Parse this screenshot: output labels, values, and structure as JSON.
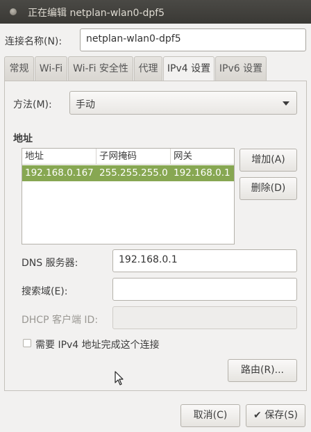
{
  "window": {
    "title": "正在编辑 netplan-wlan0-dpf5"
  },
  "connection": {
    "label": "连接名称(N):",
    "value": "netplan-wlan0-dpf5"
  },
  "tabs": [
    {
      "label": "常规"
    },
    {
      "label": "Wi-Fi"
    },
    {
      "label": "Wi-Fi 安全性"
    },
    {
      "label": "代理"
    },
    {
      "label": "IPv4 设置"
    },
    {
      "label": "IPv6 设置"
    }
  ],
  "active_tab": "IPv4 设置",
  "ipv4": {
    "method_label": "方法(M):",
    "method_value": "手动",
    "addresses_heading": "地址",
    "table": {
      "headers": [
        "地址",
        "子网掩码",
        "网关"
      ],
      "rows": [
        [
          "192.168.0.167",
          "255.255.255.0",
          "192.168.0.1"
        ]
      ]
    },
    "add_button": "增加(A)",
    "delete_button": "删除(D)",
    "dns_label": "DNS 服务器:",
    "dns_value": "192.168.0.1",
    "search_label": "搜索域(E):",
    "search_value": "",
    "dhcp_label": "DHCP 客户端 ID:",
    "dhcp_value": "",
    "require_ipv4_label": "需要 IPv4 地址完成这个连接",
    "require_ipv4_checked": false,
    "routes_button": "路由(R)..."
  },
  "footer": {
    "cancel_button": "取消(C)",
    "save_button": "保存(S)"
  }
}
